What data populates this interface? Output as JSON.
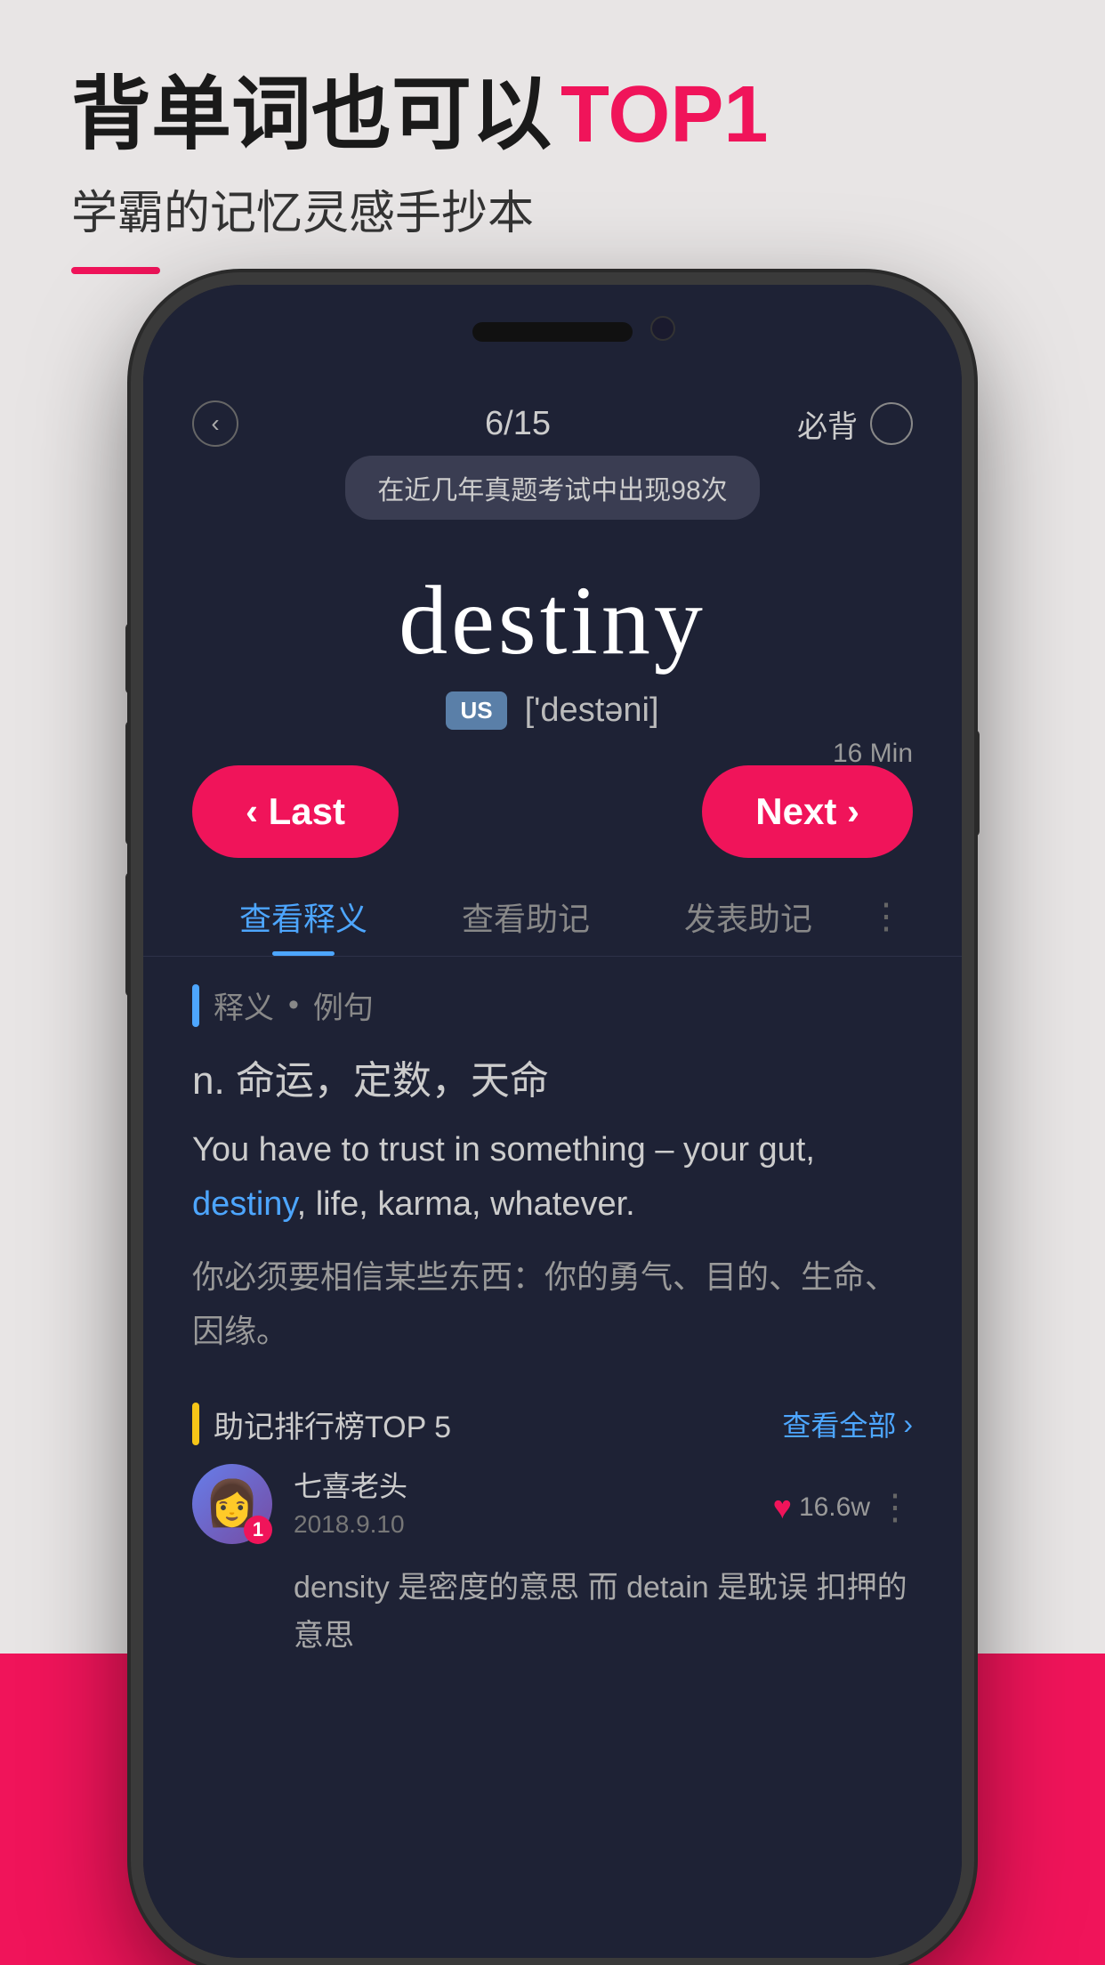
{
  "header": {
    "title_part1": "背单词也可以",
    "title_highlight": "TOP1",
    "subtitle": "学霸的记忆灵感手抄本"
  },
  "phone": {
    "topbar": {
      "back_label": "‹",
      "progress": "6/15",
      "must_memorize_label": "必背"
    },
    "tooltip": "在近几年真题考试中出现98次",
    "word": {
      "text": "destiny",
      "phonetic_label": "US",
      "phonetic": "['destəni]"
    },
    "timer_label": "16 Min",
    "buttons": {
      "last": "‹ Last",
      "next": "Next ›"
    },
    "tabs": [
      {
        "label": "查看释义",
        "active": true
      },
      {
        "label": "查看助记",
        "active": false
      },
      {
        "label": "发表助记",
        "active": false
      }
    ],
    "definition_section": {
      "label_text": "释义",
      "dot": "•",
      "example_label": "例句",
      "pos": "n.  命运，定数，天命",
      "example_en_prefix": "You have to trust in something –\nyour gut, ",
      "example_word": "destiny",
      "example_en_suffix": ", life, karma, whatever.",
      "example_zh": "你必须要相信某些东西：你的勇气、目的、生命、\n因缘。"
    },
    "mnemonics_section": {
      "label": "助记排行榜TOP 5",
      "view_all": "查看全部",
      "entries": [
        {
          "rank": "1",
          "avatar_text": "👩",
          "username": "七喜老头",
          "date": "2018.9.10",
          "likes": "16.6w",
          "content": "density 是密度的意思 而 detain 是耽误\n扣押的意思"
        }
      ]
    }
  }
}
